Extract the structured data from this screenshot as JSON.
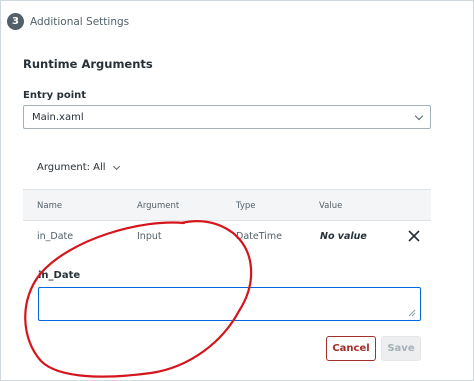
{
  "step": {
    "number": "3",
    "title": "Additional Settings"
  },
  "runtime": {
    "section_title": "Runtime Arguments",
    "entry_point": {
      "label": "Entry point",
      "value": "Main.xaml"
    },
    "filter_label": "Argument: All"
  },
  "table": {
    "headers": [
      "Name",
      "Argument",
      "Type",
      "Value"
    ],
    "row": {
      "name": "in_Date",
      "argument": "Input",
      "type": "DateTime",
      "value": "No value"
    }
  },
  "editor": {
    "label": "in_Date",
    "value": ""
  },
  "buttons": {
    "cancel": "Cancel",
    "save": "Save"
  },
  "colors": {
    "accent": "#0067df",
    "cancel": "#a22f2a",
    "annotation": "#d4161c"
  },
  "icons": {
    "close": "close-icon",
    "dropdown": "chevron-down-icon"
  }
}
